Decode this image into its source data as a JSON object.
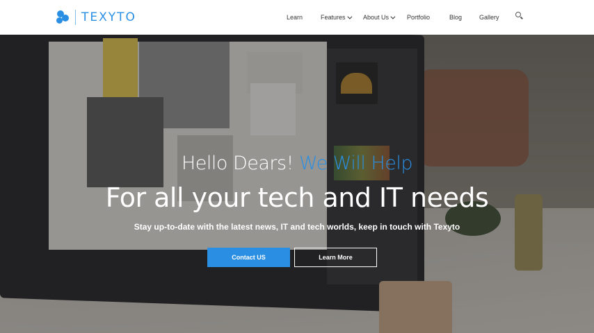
{
  "brand": {
    "name": "TEXYTO",
    "color": "#2a8fe3"
  },
  "nav": {
    "items": [
      {
        "label": "Learn",
        "dropdown": false
      },
      {
        "label": "Features",
        "dropdown": true
      },
      {
        "label": "About Us",
        "dropdown": true
      },
      {
        "label": "Portfolio",
        "dropdown": false
      },
      {
        "label": "Blog",
        "dropdown": false
      },
      {
        "label": "Gallery",
        "dropdown": false
      }
    ],
    "search_icon": "search-icon"
  },
  "hero": {
    "greeting_prefix": "Hello Dears!",
    "greeting_accent": "We Will Help",
    "headline": "For all your tech and IT needs",
    "subtitle": "Stay up-to-date with the latest news, IT and tech worlds, keep in touch with Texyto",
    "primary_button": "Contact US",
    "secondary_button": "Learn More"
  }
}
